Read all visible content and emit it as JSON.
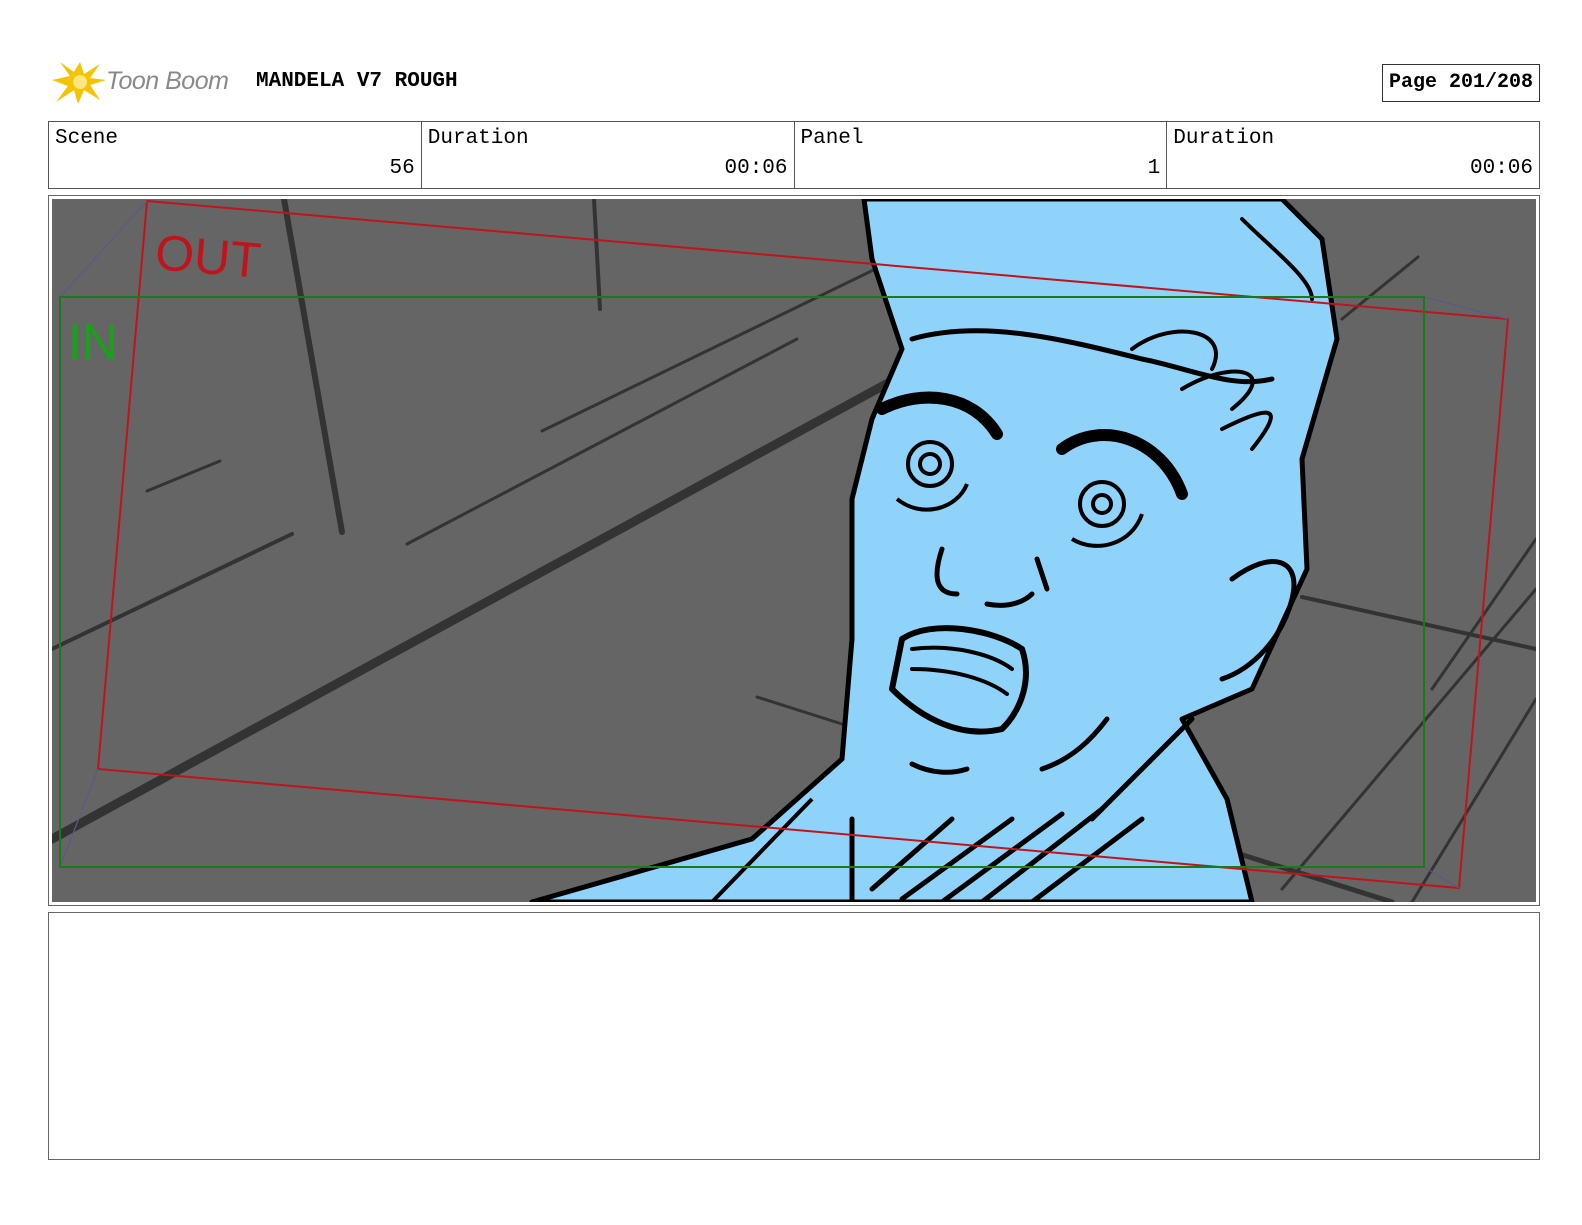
{
  "header": {
    "logo_text": "Toon Boom",
    "project_title": "MANDELA V7 ROUGH",
    "page_label": "Page 201/208"
  },
  "info": {
    "scene_label": "Scene",
    "scene_value": "56",
    "scene_duration_label": "Duration",
    "scene_duration_value": "00:06",
    "panel_label": "Panel",
    "panel_value": "1",
    "panel_duration_label": "Duration",
    "panel_duration_value": "00:06"
  },
  "panel": {
    "out_label": "OUT",
    "in_label": "IN",
    "colors": {
      "background": "#656565",
      "character_fill": "#8fd3fb",
      "out_frame": "#c0141c",
      "in_frame": "#1a7a1a"
    }
  },
  "notes": {
    "text": ""
  }
}
